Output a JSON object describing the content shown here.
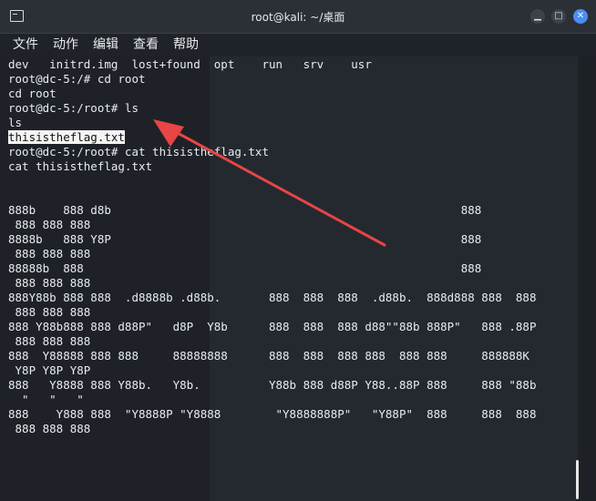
{
  "window": {
    "title": "root@kali: ~/桌面"
  },
  "menu": [
    "文件",
    "动作",
    "编辑",
    "查看",
    "帮助"
  ],
  "terminal_lines": [
    "dev   initrd.img  lost+found  opt    run   srv    usr",
    "root@dc-5:/# cd root",
    "cd root",
    "root@dc-5:/root# ls",
    "ls",
    "thisistheflag.txt",
    "root@dc-5:/root# cat thisistheflag.txt",
    "cat thisistheflag.txt",
    "",
    "",
    "888b    888 d8b                                                   888",
    " 888 888 888",
    "8888b   888 Y8P                                                   888",
    " 888 888 888",
    "88888b  888                                                       888",
    " 888 888 888",
    "888Y88b 888 888  .d8888b .d88b.       888  888  888  .d88b.  888d888 888  888",
    " 888 888 888",
    "888 Y88b888 888 d88P\"   d8P  Y8b      888  888  888 d88\"\"88b 888P\"   888 .88P",
    " 888 888 888",
    "888  Y88888 888 888     88888888      888  888  888 888  888 888     888888K",
    " Y8P Y8P Y8P",
    "888   Y8888 888 Y88b.   Y8b.          Y88b 888 d88P Y88..88P 888     888 \"88b",
    "  \"   \"   \"",
    "888    Y888 888  \"Y8888P \"Y8888        \"Y8888888P\"   \"Y88P\"  888     888  888",
    " 888 888 888"
  ],
  "colors": {
    "arrow": "#e84545",
    "highlight_bg": "#f4f4f4",
    "close_button": "#4b8df3"
  },
  "icons": [
    "terminal-icon",
    "minimize-icon",
    "maximize-icon",
    "close-icon",
    "arrow-annotation"
  ]
}
